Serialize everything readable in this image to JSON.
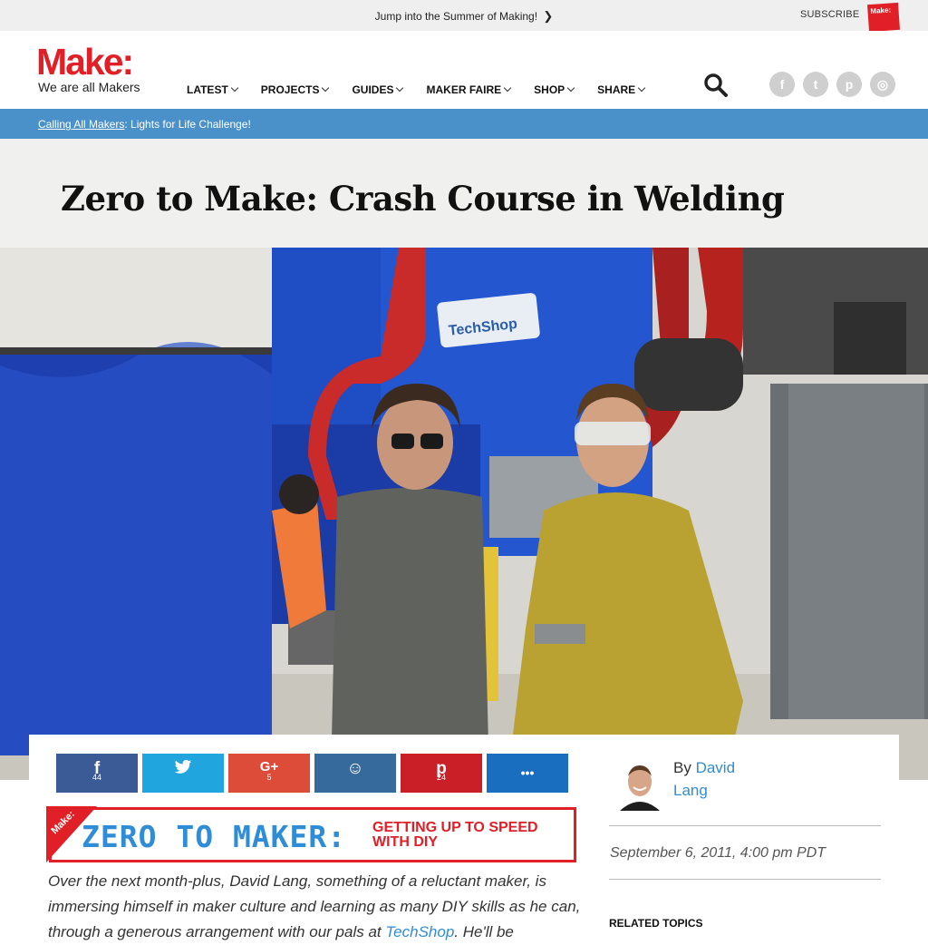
{
  "topbar": {
    "promo_text": "Jump into the Summer of Making!",
    "promo_chevron": "❯",
    "subscribe_label": "SUBSCRIBE",
    "magazine_label": "Make:"
  },
  "header": {
    "logo": "Make:",
    "tagline": "We are all Makers",
    "nav": [
      {
        "label": "LATEST"
      },
      {
        "label": "PROJECTS"
      },
      {
        "label": "GUIDES"
      },
      {
        "label": "MAKER FAIRE"
      },
      {
        "label": "SHOP"
      },
      {
        "label": "SHARE"
      }
    ],
    "social_icons": [
      "facebook-icon",
      "twitter-icon",
      "pinterest-icon",
      "instagram-icon"
    ],
    "social_glyphs": {
      "facebook": "f",
      "twitter": "t",
      "pinterest": "p",
      "instagram": "◎"
    }
  },
  "banner": {
    "link_text": "Calling All Makers",
    "text": ": Lights for Life Challenge!"
  },
  "article": {
    "title": "Zero to Make: Crash Course in Welding",
    "hero_sign": "TechShop",
    "share": [
      {
        "network": "facebook",
        "glyph": "f",
        "count": "44",
        "color": "#3b5b96"
      },
      {
        "network": "twitter",
        "glyph": "🐦",
        "count": "",
        "color": "#21a5df"
      },
      {
        "network": "google-plus",
        "glyph": "G+",
        "count": "5",
        "color": "#dd4b39"
      },
      {
        "network": "reddit",
        "glyph": "☺",
        "count": "",
        "color": "#376a9c"
      },
      {
        "network": "pinterest",
        "glyph": "p",
        "count": "24",
        "color": "#cb1f27"
      },
      {
        "network": "more",
        "glyph": "•••",
        "count": "",
        "color": "#1a6ebf"
      }
    ],
    "series_banner": {
      "corner": "Make:",
      "big": "ZERO TO MAKER:",
      "small_line1": "GETTING UP TO SPEED",
      "small_line2": "WITH DIY"
    },
    "body_before": "Over the next month-plus, David Lang, something of a reluctant maker, is immersing himself in maker culture and learning as many DIY skills as he can, through a generous arrangement with our pals at ",
    "body_link": "TechShop",
    "body_after": ". He'll be",
    "author_by": "By",
    "author_name": "David Lang",
    "date": "September 6, 2011, 4:00 pm PDT",
    "related_heading": "RELATED TOPICS"
  },
  "colors": {
    "brand_red": "#e01f26",
    "banner_blue": "#4b91c9",
    "link_blue": "#2f8cd6"
  }
}
